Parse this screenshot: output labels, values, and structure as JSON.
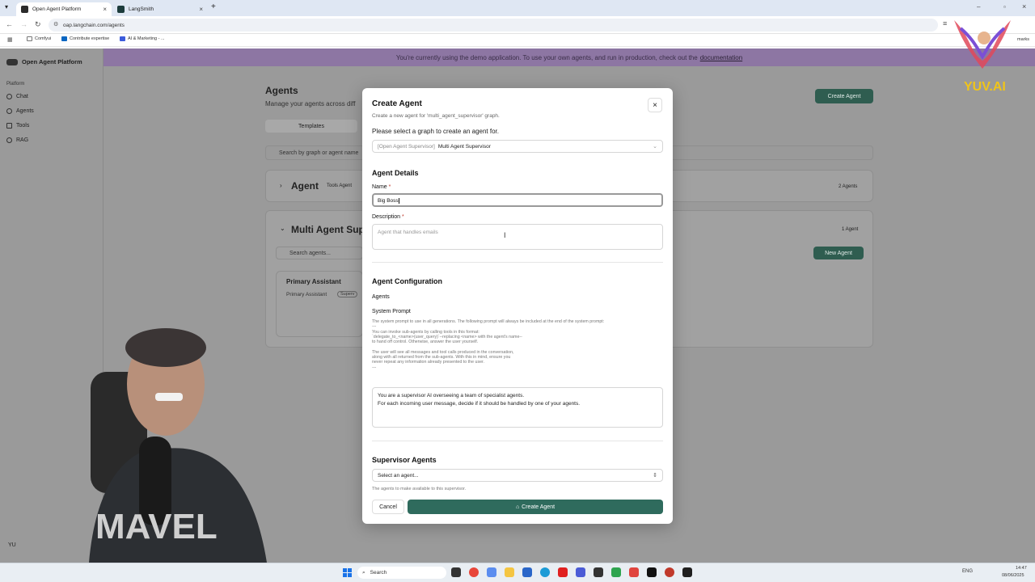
{
  "browser": {
    "tabs": [
      {
        "label": "Open Agent Platform",
        "active": true
      },
      {
        "label": "LangSmith",
        "active": false
      }
    ],
    "new_tab": "+",
    "url": "oap.langchain.com/agents",
    "bookmarks": [
      "Comfyui",
      "Contribute expertise",
      "AI & Marketing - ...",
      "marks"
    ]
  },
  "banner": {
    "text": "You're currently using the demo application. To use your own agents, and run in production, check out the",
    "link": "documentation"
  },
  "sidebar": {
    "brand": "Open Agent Platform",
    "section": "Platform",
    "items": [
      "Chat",
      "Agents",
      "Tools",
      "RAG"
    ],
    "user_initials": "YU"
  },
  "main": {
    "title": "Agents",
    "subtitle": "Manage your agents across diff",
    "tab_templates": "Templates",
    "search_placeholder": "Search by graph or agent name",
    "create_button": "Create Agent",
    "group1": {
      "title": "Agent",
      "badge": "Tools Agent",
      "count": "2 Agents"
    },
    "group2": {
      "title": "Multi Agent Sup",
      "count": "1 Agent",
      "search_placeholder": "Search agents...",
      "new_button": "New Agent"
    },
    "card": {
      "title": "Primary Assistant",
      "subtitle": "Primary Assistant",
      "badge": "Superv"
    }
  },
  "modal": {
    "title": "Create Agent",
    "subtitle": "Create a new agent for 'multi_agent_supervisor' graph.",
    "close": "×",
    "graph_prompt": "Please select a graph to create an agent for.",
    "graph_prefix": "[Open Agent Supervisor]",
    "graph_value": "Multi Agent Supervisor",
    "details_heading": "Agent Details",
    "name_label": "Name",
    "name_value": "Big Boss",
    "description_label": "Description",
    "description_placeholder": "Agent that handles emails",
    "required_mark": "*",
    "config_heading": "Agent Configuration",
    "agents_label": "Agents",
    "system_prompt_label": "System Prompt",
    "system_prompt_help": "The system prompt to use in all generations. The following prompt will always be included at the end of the system prompt:\n---\nYou can invoke sub-agents by calling tools in this format:\n`delegate_to_<name>(user_query)`--replacing <name> with the agent's name--\nto hand off control. Otherwise, answer the user yourself.\n\nThe user will see all messages and tool calls produced in the conversation,\nalong with all returned from the sub-agents. With this in mind, ensure you\nnever repeat any information already presented to the user.\n---",
    "system_prompt_value": "You are a supervisor AI overseeing a team of specialist agents.\nFor each incoming user message, decide if it should be handled by one of your agents.",
    "supervisor_heading": "Supervisor Agents",
    "select_placeholder": "Select an agent...",
    "select_help": "The agents to make available to this supervisor.",
    "cancel": "Cancel",
    "create": "Create Agent"
  },
  "overlay": {
    "logo_text": "YUV.AI"
  },
  "taskbar": {
    "search": "Search",
    "lang": "ENG",
    "time": "14:47",
    "date": "08/06/2025"
  },
  "colors": {
    "accent": "#2f6b5d",
    "banner": "#8d76a3",
    "required": "#c0392b"
  }
}
